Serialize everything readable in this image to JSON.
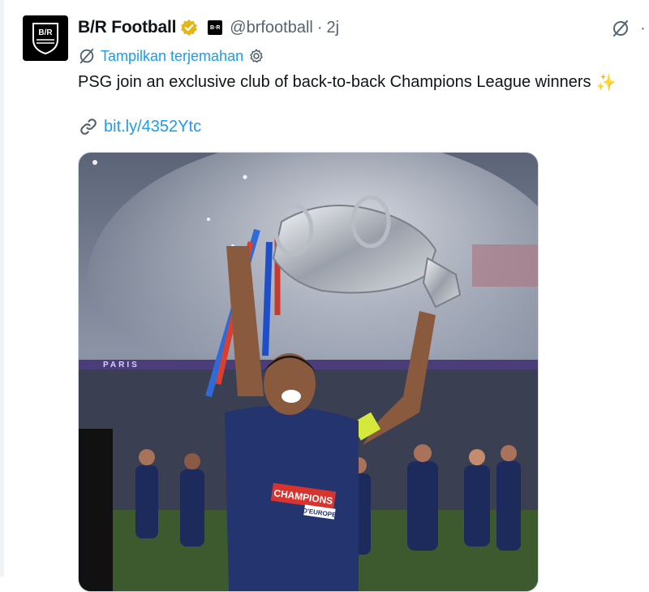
{
  "tweet": {
    "display_name": "B/R Football",
    "handle": "@brfootball",
    "separator": "·",
    "time": "2j",
    "avatar_text": "B/R",
    "affiliate_badge_text": "B·R",
    "translate_label": "Tampilkan terjemahan",
    "text": "PSG join an exclusive club of back-to-back Champions League winners",
    "emoji": "✨",
    "link": "bit.ly/4352Ytc",
    "more": "·"
  },
  "media": {
    "shirt_text_1": "CHAMPIONS",
    "shirt_text_2": "D'EUROPE",
    "board_text": "PARIS"
  },
  "colors": {
    "accent": "#1d9bf0",
    "secondary_text": "#536471",
    "verified_gold": "#e2b719"
  }
}
